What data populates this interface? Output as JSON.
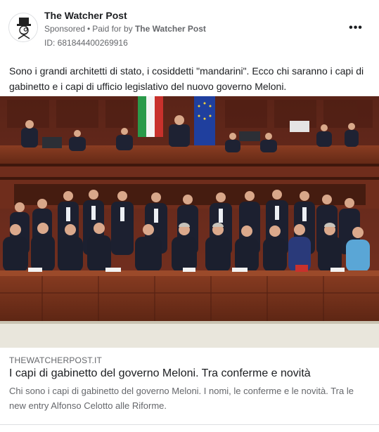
{
  "header": {
    "page_name": "The Watcher Post",
    "sponsored_label": "Sponsored",
    "separator": "•",
    "paid_for_prefix": "Paid for by",
    "paid_for_by": "The Watcher Post",
    "ad_id": "ID: 681844400269916",
    "more_icon": "more-horizontal-icon",
    "more_label": "•••"
  },
  "post": {
    "text": "Sono i grandi architetti di stato, i cosiddetti \"mandarini\". Ecco chi saranno i capi di gabinetto e i capi di ufficio legislativo del nuovo governo Meloni."
  },
  "link_preview": {
    "domain": "THEWATCHERPOST.IT",
    "title": "I capi di gabinetto del governo Meloni. Tra conferme e novità",
    "description": "Chi sono i capi di gabinetto del governo Meloni. I nomi, le conferme e le novità. Tra le new entry Alfonso Celotto alle Riforme."
  },
  "colors": {
    "text_primary": "#1c1e21",
    "text_secondary": "#65676b",
    "border": "#dddfe2",
    "wood": "#6b2a1c"
  }
}
